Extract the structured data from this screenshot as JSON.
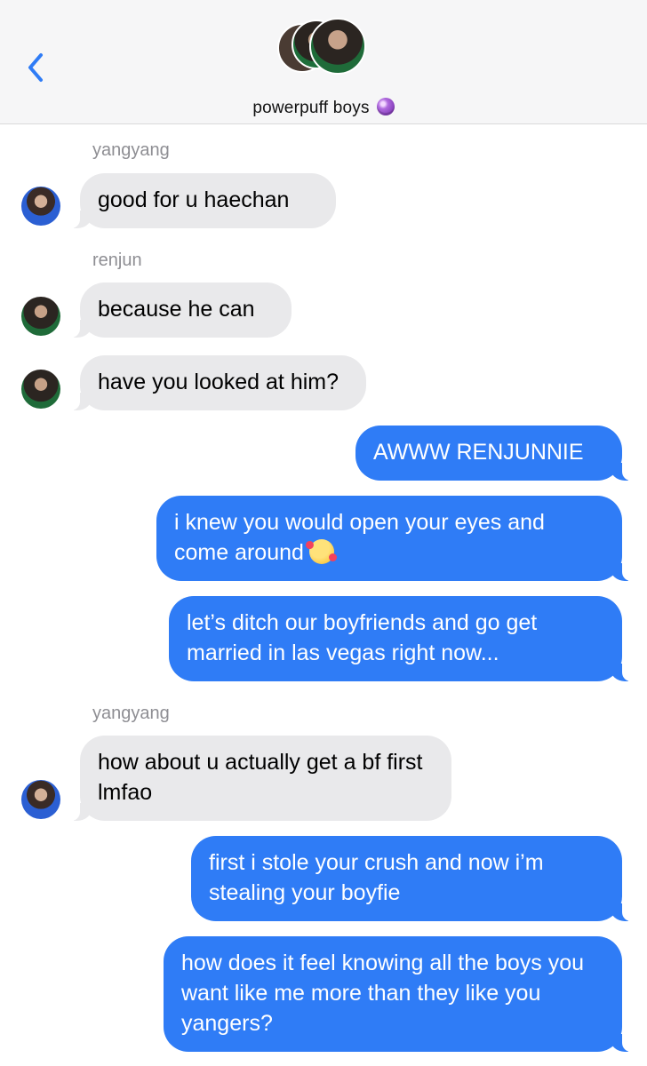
{
  "header": {
    "title": "powerpuff boys",
    "title_icon": "crystal-ball-icon",
    "back_icon": "chevron-left-icon",
    "accent_color": "#2f7cf6"
  },
  "messages": [
    {
      "sender": "yangyang",
      "direction": "incoming",
      "text": "good for u haechan"
    },
    {
      "sender": "renjun",
      "direction": "incoming",
      "text": "because he can"
    },
    {
      "sender": "renjun",
      "direction": "incoming",
      "text": "have you looked at him?"
    },
    {
      "direction": "outgoing",
      "text": "AWWW RENJUNNIE"
    },
    {
      "direction": "outgoing",
      "text": "i knew you would open your eyes and come around",
      "emoji": "smiling-face-with-hearts-emoji"
    },
    {
      "direction": "outgoing",
      "text": "let’s ditch our boyfriends and go get married in las vegas right now..."
    },
    {
      "sender": "yangyang",
      "direction": "incoming",
      "text": "how about u actually get a bf first lmfao"
    },
    {
      "direction": "outgoing",
      "text": "first i stole your crush and now i’m stealing your boyfie"
    },
    {
      "direction": "outgoing",
      "text": "how does it feel knowing all the boys you want like me more than they like you yangers?"
    }
  ],
  "colors": {
    "incoming_bubble": "#e9e9eb",
    "outgoing_bubble": "#2f7cf6",
    "sender_label": "#8e8e93"
  }
}
